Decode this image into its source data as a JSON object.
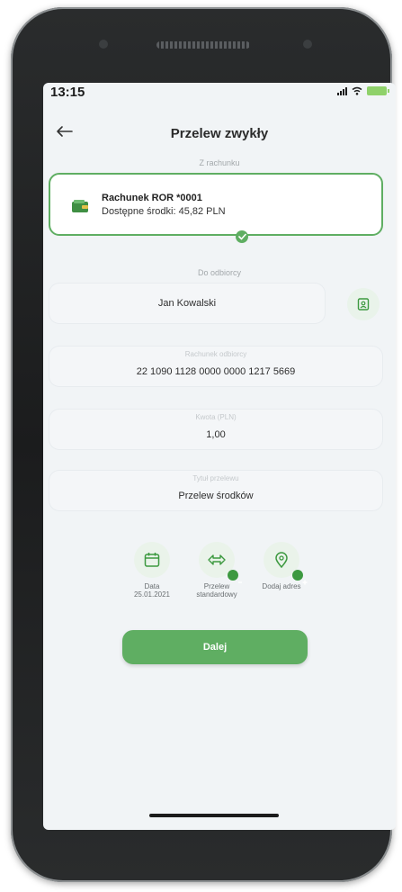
{
  "status_bar": {
    "time": "13:15"
  },
  "header": {
    "title": "Przelew zwykły"
  },
  "from_account": {
    "section_label": "Z rachunku",
    "name": "Rachunek ROR *0001",
    "balance": "Dostępne środki: 45,82 PLN"
  },
  "recipient": {
    "section_label": "Do odbiorcy",
    "name": "Jan Kowalski"
  },
  "recipient_account": {
    "placeholder": "Rachunek odbiorcy",
    "value": "22 1090 1128 0000 0000 1217 5669"
  },
  "amount": {
    "placeholder": "Kwota (PLN)",
    "value": "1,00"
  },
  "title_field": {
    "placeholder": "Tytuł przelewu",
    "value": "Przelew środków"
  },
  "options": [
    {
      "line1": "Data",
      "line2": "25.01.2021"
    },
    {
      "line1": "Przelew",
      "line2": "standardowy"
    },
    {
      "line1": "Dodaj adres",
      "line2": ""
    }
  ],
  "next_button": {
    "label": "Dalej"
  },
  "colors": {
    "accent": "#5fae62",
    "accent_dark": "#3d9940",
    "screen_background": "#f1f4f6"
  }
}
